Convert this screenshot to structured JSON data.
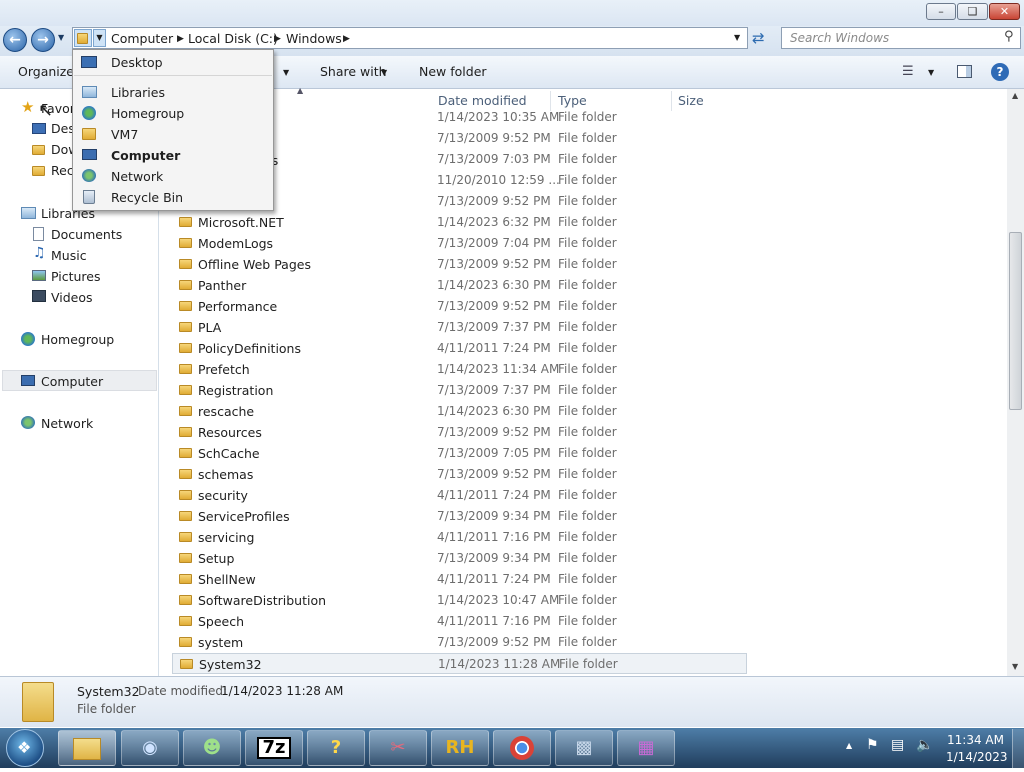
{
  "address": {
    "crumbs": [
      "Computer",
      "Local Disk (C:)",
      "Windows"
    ],
    "search_placeholder": "Search Windows"
  },
  "toolbar": {
    "organize": "Organize",
    "share_with": "Share with",
    "new_folder": "New folder"
  },
  "dropdown": {
    "items": [
      "Desktop",
      "Libraries",
      "Homegroup",
      "VM7",
      "Computer",
      "Network",
      "Recycle Bin"
    ],
    "bold_item": "Computer"
  },
  "nav": {
    "favorites_partial": "Favori",
    "desktop_partial": "Desk",
    "downloads_partial": "Dow",
    "recent_partial": "Rec",
    "libraries": "Libraries",
    "library_items": [
      "Documents",
      "Music",
      "Pictures",
      "Videos"
    ],
    "homegroup": "Homegroup",
    "computer": "Computer",
    "network": "Network"
  },
  "columns": {
    "name_sort_icon": "sort-up-icon",
    "date": "Date modified",
    "type": "Type",
    "size": "Size"
  },
  "partial_row_text": "orts",
  "files": [
    {
      "name": "",
      "date": "1/14/2023 10:35 AM",
      "type": "File folder"
    },
    {
      "name": "",
      "date": "7/13/2009 9:52 PM",
      "type": "File folder"
    },
    {
      "name": "",
      "date": "7/13/2009 7:03 PM",
      "type": "File folder"
    },
    {
      "name": "",
      "date": "11/20/2010 12:59 ...",
      "type": "File folder"
    },
    {
      "name": "",
      "date": "7/13/2009 9:52 PM",
      "type": "File folder"
    },
    {
      "name": "Microsoft.NET",
      "date": "1/14/2023 6:32 PM",
      "type": "File folder"
    },
    {
      "name": "ModemLogs",
      "date": "7/13/2009 7:04 PM",
      "type": "File folder"
    },
    {
      "name": "Offline Web Pages",
      "date": "7/13/2009 9:52 PM",
      "type": "File folder"
    },
    {
      "name": "Panther",
      "date": "1/14/2023 6:30 PM",
      "type": "File folder"
    },
    {
      "name": "Performance",
      "date": "7/13/2009 9:52 PM",
      "type": "File folder"
    },
    {
      "name": "PLA",
      "date": "7/13/2009 7:37 PM",
      "type": "File folder"
    },
    {
      "name": "PolicyDefinitions",
      "date": "4/11/2011 7:24 PM",
      "type": "File folder"
    },
    {
      "name": "Prefetch",
      "date": "1/14/2023 11:34 AM",
      "type": "File folder"
    },
    {
      "name": "Registration",
      "date": "7/13/2009 7:37 PM",
      "type": "File folder"
    },
    {
      "name": "rescache",
      "date": "1/14/2023 6:30 PM",
      "type": "File folder"
    },
    {
      "name": "Resources",
      "date": "7/13/2009 9:52 PM",
      "type": "File folder"
    },
    {
      "name": "SchCache",
      "date": "7/13/2009 7:05 PM",
      "type": "File folder"
    },
    {
      "name": "schemas",
      "date": "7/13/2009 9:52 PM",
      "type": "File folder"
    },
    {
      "name": "security",
      "date": "4/11/2011 7:24 PM",
      "type": "File folder"
    },
    {
      "name": "ServiceProfiles",
      "date": "7/13/2009 9:34 PM",
      "type": "File folder"
    },
    {
      "name": "servicing",
      "date": "4/11/2011 7:16 PM",
      "type": "File folder"
    },
    {
      "name": "Setup",
      "date": "7/13/2009 9:34 PM",
      "type": "File folder"
    },
    {
      "name": "ShellNew",
      "date": "4/11/2011 7:24 PM",
      "type": "File folder"
    },
    {
      "name": "SoftwareDistribution",
      "date": "1/14/2023 10:47 AM",
      "type": "File folder"
    },
    {
      "name": "Speech",
      "date": "4/11/2011 7:16 PM",
      "type": "File folder"
    },
    {
      "name": "system",
      "date": "7/13/2009 9:52 PM",
      "type": "File folder"
    },
    {
      "name": "System32",
      "date": "1/14/2023 11:28 AM",
      "type": "File folder"
    }
  ],
  "selected_index": 26,
  "details": {
    "name": "System32",
    "date_label": "Date modified:",
    "date_value": "1/14/2023 11:28 AM",
    "type": "File folder"
  },
  "taskbar": {
    "apps": [
      "windows-explorer-icon",
      "browser-icon",
      "users-icon",
      "7z",
      "help-icon",
      "tools-icon",
      "RH",
      "chrome-icon",
      "computer-icon",
      "archive-icon"
    ],
    "seven_zip_label": "7z",
    "rh_label": "RH",
    "time": "11:34 AM",
    "date": "1/14/2023"
  },
  "colors": {
    "accent": "#3c7fb1",
    "taskbar": "#2b4f74",
    "folder": "#e8be4a"
  }
}
